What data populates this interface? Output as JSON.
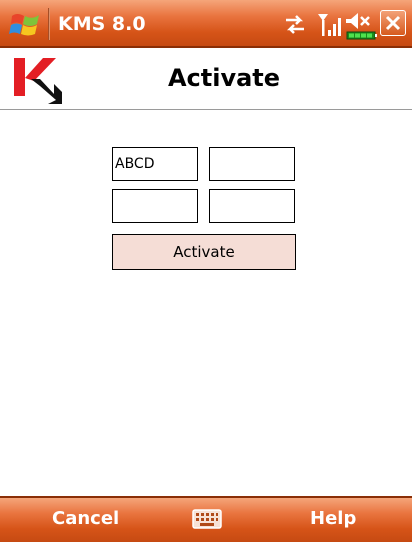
{
  "statusbar": {
    "app_title": "KMS 8.0",
    "icons": [
      "windows-start-icon",
      "connectivity-icon",
      "signal-strength-icon",
      "volume-muted-icon",
      "battery-icon",
      "close-icon"
    ]
  },
  "header": {
    "logo_icon": "kaspersky-logo-icon",
    "title": "Activate"
  },
  "activation": {
    "key_fields": [
      {
        "value": "ABCD",
        "placeholder": ""
      },
      {
        "value": "",
        "placeholder": ""
      },
      {
        "value": "",
        "placeholder": ""
      },
      {
        "value": "",
        "placeholder": ""
      }
    ],
    "activate_label": "Activate"
  },
  "softkeys": {
    "left_label": "Cancel",
    "right_label": "Help",
    "center_icon": "keyboard-icon"
  },
  "colors": {
    "bar_orange": "#d65418",
    "button_fill": "#f5ddd6",
    "logo_red": "#e31e24"
  }
}
